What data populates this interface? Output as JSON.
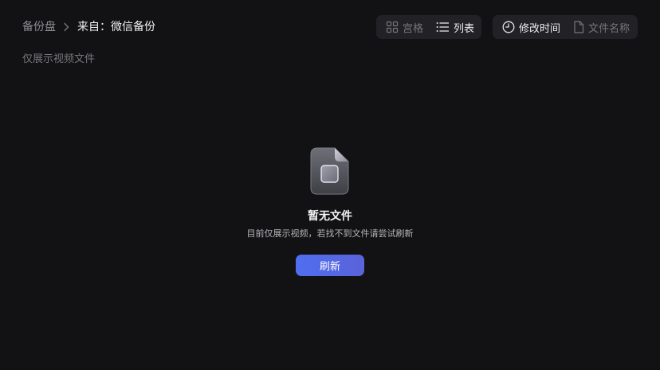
{
  "breadcrumb": {
    "root": "备份盘",
    "current": "来自：微信备份"
  },
  "view_toggle": {
    "grid_label": "宫格",
    "list_label": "列表",
    "active": "list"
  },
  "sort_toggle": {
    "modified_label": "修改时间",
    "name_label": "文件名称",
    "active": "modified"
  },
  "filter_note": "仅展示视频文件",
  "empty_state": {
    "title": "暂无文件",
    "description": "目前仅展示视频，若找不到文件请尝试刷新",
    "button_label": "刷新"
  },
  "icons": {
    "chevron": "chevron-right-icon",
    "grid": "grid-icon",
    "list": "list-icon",
    "clock": "clock-icon",
    "file": "file-icon",
    "empty_file": "empty-file-icon"
  },
  "colors": {
    "background": "#121214",
    "toolbar_bg": "#222226",
    "accent": "#5068ee"
  }
}
